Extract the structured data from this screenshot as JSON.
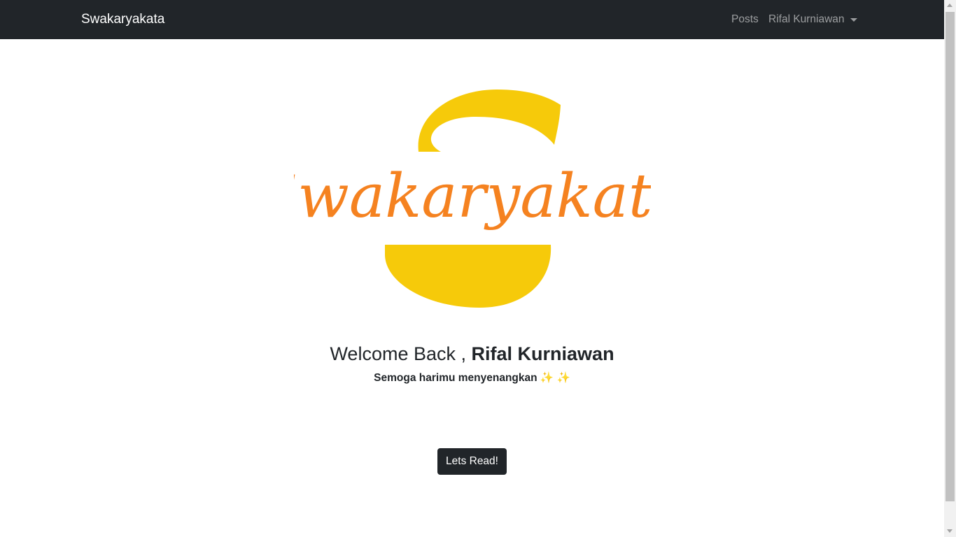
{
  "navbar": {
    "brand": "Swakaryakata",
    "links": {
      "posts": "Posts",
      "user": "Rifal Kurniawan"
    }
  },
  "hero": {
    "logo_text": "Swakaryakata",
    "welcome_prefix": "Welcome Back ,",
    "user_name": "Rifal Kurniawan",
    "subtitle": "Semoga harimu menyenangkan",
    "sparkles": "✨ ✨",
    "button_label": "Lets Read!"
  },
  "colors": {
    "navbar_bg": "#212529",
    "logo_yellow": "#f6ca0a",
    "logo_orange": "#f58220",
    "button_bg": "#212529"
  },
  "icons": {
    "user_menu": "caret-down-icon"
  }
}
